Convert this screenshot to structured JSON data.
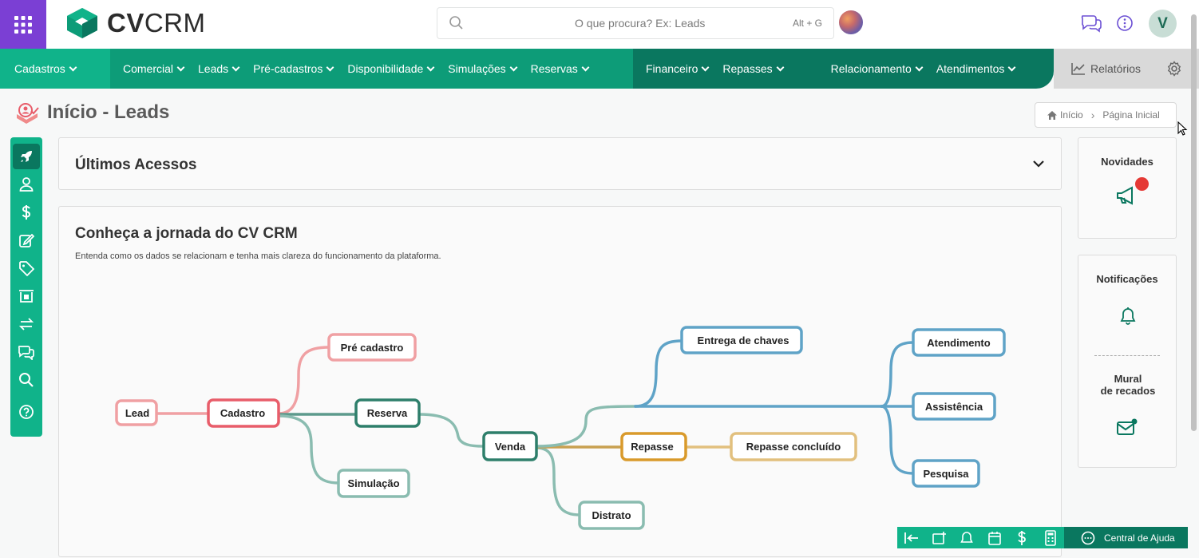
{
  "brand": {
    "name_bold": "CV",
    "name_light": "CRM"
  },
  "search": {
    "placeholder": "O que procura? Ex: Leads",
    "shortcut": "Alt + G"
  },
  "user": {
    "initial": "V"
  },
  "nav": {
    "group1": [
      "Cadastros"
    ],
    "group2": [
      "Comercial",
      "Leads",
      "Pré-cadastros",
      "Disponibilidade",
      "Simulações",
      "Reservas"
    ],
    "group3": [
      "Financeiro",
      "Repasses",
      "Relacionamento",
      "Atendimentos"
    ],
    "reports": "Relatórios"
  },
  "page": {
    "title": "Início - Leads"
  },
  "breadcrumb": {
    "home": "Início",
    "current": "Página Inicial"
  },
  "recent": {
    "title": "Últimos Acessos"
  },
  "journey": {
    "title": "Conheça a jornada do CV CRM",
    "subtitle": "Entenda como os dados se relacionam e tenha mais clareza do funcionamento da plataforma.",
    "nodes": {
      "lead": "Lead",
      "cadastro": "Cadastro",
      "pre_cadastro": "Pré cadastro",
      "reserva": "Reserva",
      "simulacao": "Simulação",
      "venda": "Venda",
      "distrato": "Distrato",
      "repasse": "Repasse",
      "repasse_concluido": "Repasse concluído",
      "entrega_chaves": "Entrega de chaves",
      "atendimento": "Atendimento",
      "assistencia": "Assistência",
      "pesquisa": "Pesquisa"
    }
  },
  "side": {
    "novidades": "Novidades",
    "notificacoes": "Notificações",
    "mural_line1": "Mural",
    "mural_line2": "de recados"
  },
  "footer": {
    "help": "Central de Ajuda"
  },
  "colors": {
    "purple": "#7b3fd4",
    "green_light": "#10b38a",
    "green_mid": "#0d9c78",
    "green_dark": "#0a775f",
    "red_dot": "#e53935"
  }
}
